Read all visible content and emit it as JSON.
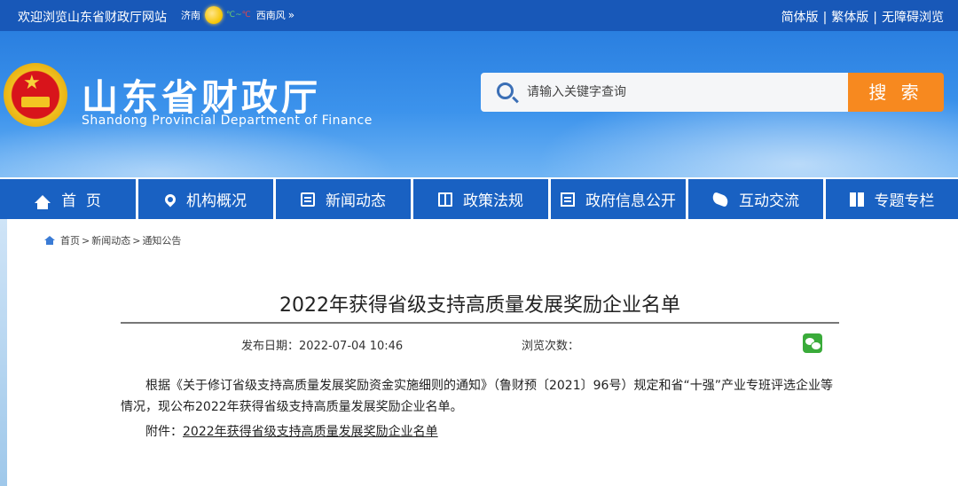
{
  "topbar": {
    "welcome": "欢迎浏览山东省财政厅网站",
    "weather": {
      "city": "济南",
      "temp_low": "℃",
      "tilde": "~",
      "temp_high": "℃",
      "wind": "西南风",
      "chevron": "»"
    },
    "links": [
      "简体版",
      "繁体版",
      "无障碍浏览"
    ],
    "separator": "|"
  },
  "header": {
    "site_name": "山东省财政厅",
    "site_name_en": "Shandong Provincial Department of Finance",
    "emblem_icon": "national-emblem-icon"
  },
  "search": {
    "placeholder": "请输入关键字查询",
    "button_label": "搜 索",
    "icon": "search-icon"
  },
  "nav": {
    "items": [
      {
        "label": "首  页",
        "icon": "home-icon"
      },
      {
        "label": "机构概况",
        "icon": "location-pin-icon"
      },
      {
        "label": "新闻动态",
        "icon": "news-icon"
      },
      {
        "label": "政策法规",
        "icon": "book-icon"
      },
      {
        "label": "政府信息公开",
        "icon": "document-icon"
      },
      {
        "label": "互动交流",
        "icon": "handshake-icon"
      },
      {
        "label": "专题专栏",
        "icon": "open-book-icon"
      }
    ],
    "color": "#1961c2"
  },
  "breadcrumb": {
    "items": [
      "首页",
      "新闻动态",
      "通知公告"
    ],
    "separator": ">"
  },
  "article": {
    "title": "2022年获得省级支持高质量发展奖励企业名单",
    "date_label": "发布日期：",
    "date": "2022-07-04 10:46",
    "views_label": "浏览次数：",
    "share_icon": "wechat-icon",
    "body": "根据《关于修订省级支持高质量发展奖励资金实施细则的通知》（鲁财预〔2021〕96号）规定和省“十强”产业专班评选企业等情况，现公布2022年获得省级支持高质量发展奖励企业名单。",
    "attachment_label": "附件：",
    "attachment_link": "2022年获得省级支持高质量发展奖励企业名单"
  },
  "colors": {
    "topbar": "#1858b8",
    "accent": "#f7891f"
  }
}
